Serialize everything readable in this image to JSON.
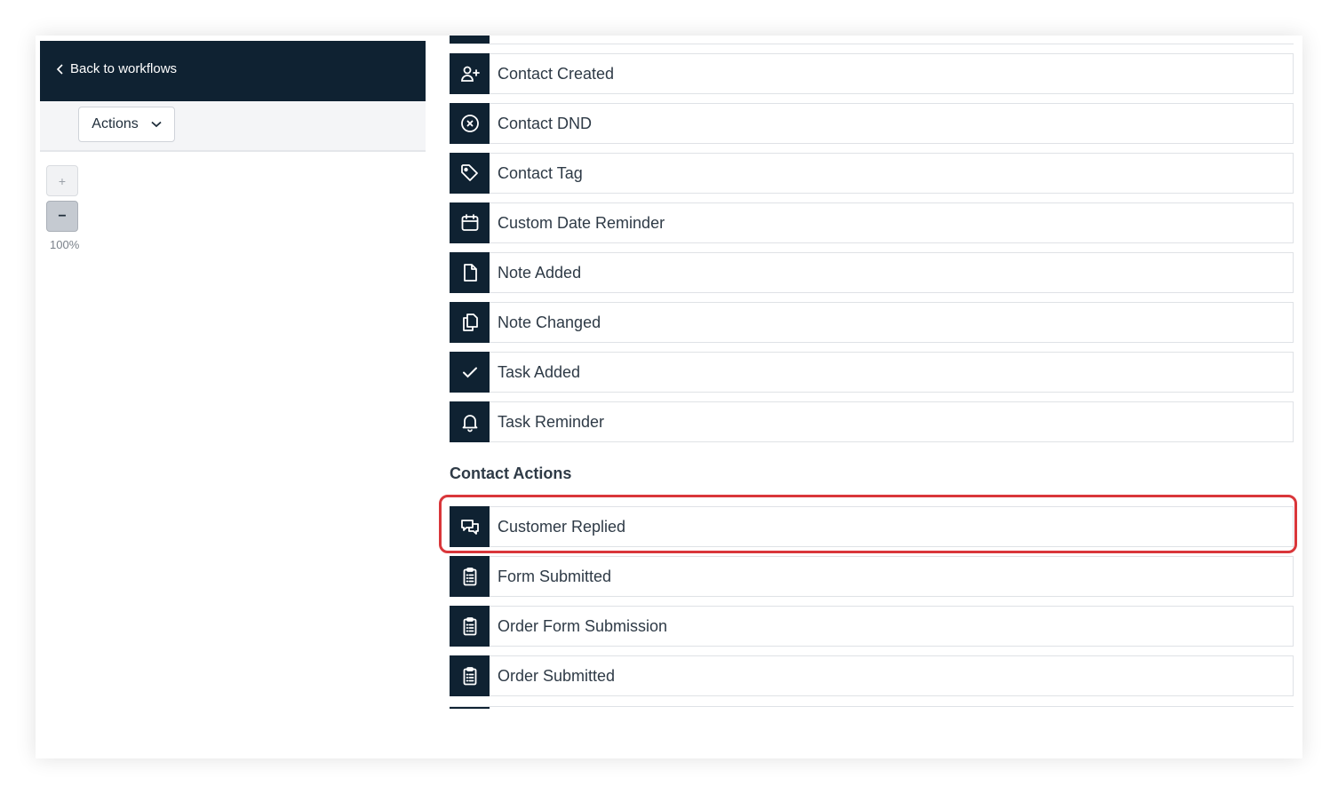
{
  "header": {
    "back_label": "Back to workflows"
  },
  "toolbar": {
    "actions_label": "Actions"
  },
  "zoom": {
    "plus": "+",
    "minus": "−",
    "level": "100%"
  },
  "triggers": {
    "items": [
      {
        "label": "Contact Created",
        "icon": "user-plus-icon"
      },
      {
        "label": "Contact DND",
        "icon": "x-circle-icon"
      },
      {
        "label": "Contact Tag",
        "icon": "tag-icon"
      },
      {
        "label": "Custom Date Reminder",
        "icon": "calendar-icon"
      },
      {
        "label": "Note Added",
        "icon": "document-icon"
      },
      {
        "label": "Note Changed",
        "icon": "documents-icon"
      },
      {
        "label": "Task Added",
        "icon": "check-icon"
      },
      {
        "label": "Task Reminder",
        "icon": "bell-icon"
      }
    ]
  },
  "contact_actions": {
    "title": "Contact Actions",
    "items": [
      {
        "label": "Customer Replied",
        "icon": "chat-icon"
      },
      {
        "label": "Form Submitted",
        "icon": "clipboard-icon"
      },
      {
        "label": "Order Form Submission",
        "icon": "clipboard-icon"
      },
      {
        "label": "Order Submitted",
        "icon": "clipboard-icon"
      }
    ]
  },
  "colors": {
    "icon_bg": "#0f2232",
    "highlight": "#d9363a",
    "topbar": "#0f2232"
  }
}
